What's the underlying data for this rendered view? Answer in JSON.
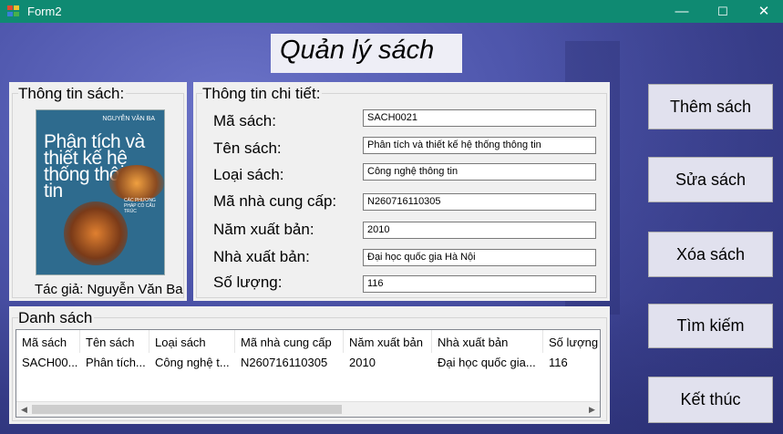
{
  "window": {
    "title": "Form2",
    "controls": {
      "minimize": "—",
      "maximize": "☐",
      "close": "✕"
    }
  },
  "header": {
    "title": "Quản lý sách"
  },
  "book_info": {
    "legend": "Thông tin sách:",
    "cover": {
      "author": "NGUYỄN VĂN BA",
      "title": "Phân tích và thiết kế hệ thống thông tin",
      "subtitle": "CÁC PHƯƠNG PHÁP CÓ CẤU TRÚC"
    },
    "author_label": "Tác giả: Nguyễn Văn Ba"
  },
  "details": {
    "legend": "Thông tin chi tiết:",
    "fields": [
      {
        "label": "Mã sách:",
        "value": "SACH0021"
      },
      {
        "label": "Tên sách:",
        "value": "Phân tích và thiết kế hệ thống thông tin"
      },
      {
        "label": "Loại sách:",
        "value": "Công nghệ thông tin"
      },
      {
        "label": "Mã nhà cung cấp:",
        "value": "N260716110305"
      },
      {
        "label": "Năm xuất bản:",
        "value": "2010"
      },
      {
        "label": "Nhà xuất bản:",
        "value": "Đại học quốc gia Hà Nội"
      },
      {
        "label": "Số lượng:",
        "value": "116"
      }
    ]
  },
  "list": {
    "legend": "Danh sách",
    "columns": [
      "Mã sách",
      "Tên sách",
      "Loại sách",
      "Mã nhà cung cấp",
      "Năm xuất bản",
      "Nhà xuất bản",
      "Số lượng"
    ],
    "rows": [
      [
        "SACH00...",
        "Phân tích...",
        "Công nghệ t...",
        "N260716110305",
        "2010",
        "Đại học quốc gia...",
        "116"
      ]
    ]
  },
  "buttons": {
    "add": "Thêm sách",
    "edit": "Sửa sách",
    "delete": "Xóa sách",
    "search": "Tìm kiếm",
    "exit": "Kết thúc"
  }
}
